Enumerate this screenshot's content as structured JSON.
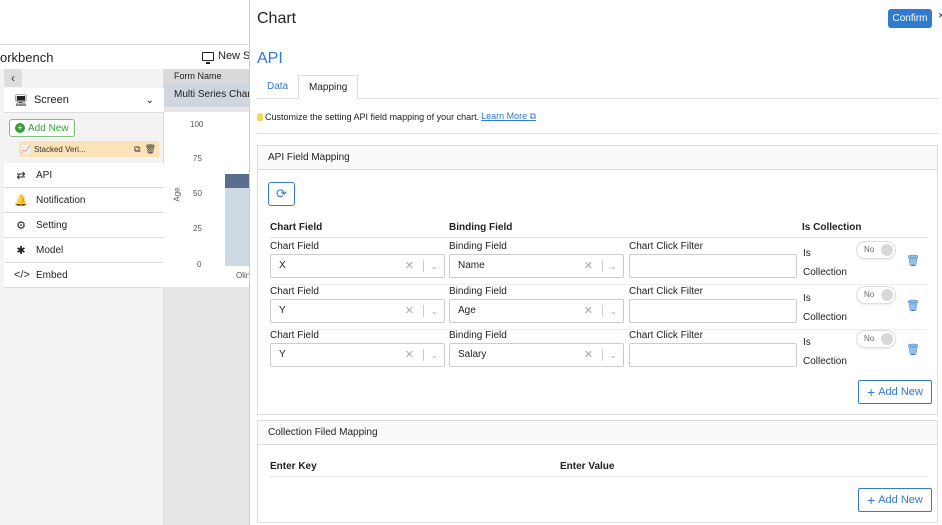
{
  "workbench": {
    "title": "orkbench",
    "new_screen_label": "New Sc",
    "back_icon": "chevron-left-icon",
    "screen_label": "Screen",
    "add_new_label": "Add New",
    "stacked_item_label": "Stacked Veri...",
    "nav": [
      {
        "label": "API",
        "icon": "arrows-exchange-icon"
      },
      {
        "label": "Notification",
        "icon": "bell-icon"
      },
      {
        "label": "Setting",
        "icon": "gear-icon"
      },
      {
        "label": "Model",
        "icon": "model-icon"
      },
      {
        "label": "Embed",
        "icon": "code-icon"
      }
    ],
    "form_name_label": "Form Name",
    "form_name_value": "Multi Series Char",
    "mini_chart": {
      "y_ticks": [
        "100",
        "75",
        "50",
        "25",
        "0"
      ],
      "y_label": "Age",
      "x_label": "Olin"
    }
  },
  "drawer": {
    "title": "Chart",
    "confirm_label": "Confirm",
    "close_glyph": "×",
    "api_heading": "API",
    "tabs": [
      {
        "label": "Data",
        "active": false
      },
      {
        "label": "Mapping",
        "active": true
      }
    ],
    "hint_text": "Customize the setting API field mapping of your chart.",
    "learn_more": "Learn More",
    "api_field_mapping": {
      "title": "API Field Mapping",
      "headers": {
        "chart_field": "Chart Field",
        "binding_field": "Binding Field",
        "is_collection": "Is Collection"
      },
      "rows": [
        {
          "chart_field_label": "Chart Field",
          "chart_field_value": "X",
          "binding_field_label": "Binding Field",
          "binding_field_value": "Name",
          "filter_label": "Chart Click Filter",
          "filter_value": "",
          "is_collection_line1": "Is",
          "is_collection_line2": "Collection",
          "toggle_text": "No"
        },
        {
          "chart_field_label": "Chart Field",
          "chart_field_value": "Y",
          "binding_field_label": "Binding Field",
          "binding_field_value": "Age",
          "filter_label": "Chart Click Filter",
          "filter_value": "",
          "is_collection_line1": "Is",
          "is_collection_line2": "Collection",
          "toggle_text": "No"
        },
        {
          "chart_field_label": "Chart Field",
          "chart_field_value": "Y",
          "binding_field_label": "Binding Field",
          "binding_field_value": "Salary",
          "filter_label": "Chart Click Filter",
          "filter_value": "",
          "is_collection_line1": "Is",
          "is_collection_line2": "Collection",
          "toggle_text": "No"
        }
      ],
      "add_new_label": "Add New"
    },
    "collection_mapping": {
      "title": "Collection Filed Mapping",
      "headers": {
        "enter_key": "Enter Key",
        "enter_value": "Enter Value"
      },
      "add_new_label": "Add New"
    }
  },
  "colors": {
    "accent": "#2f7bd0",
    "green": "#3a9a3a",
    "highlight": "#fbe3b9"
  }
}
